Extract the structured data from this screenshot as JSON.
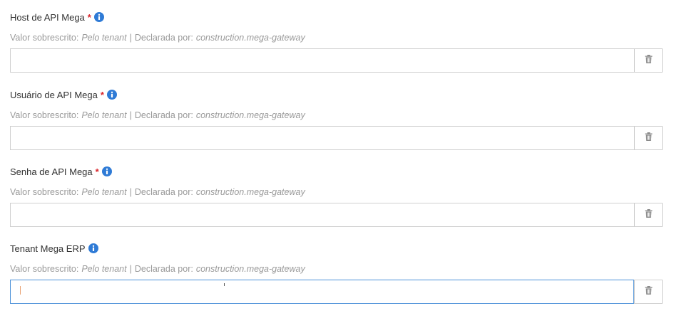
{
  "fields": [
    {
      "label": "Host de API Mega",
      "required": "*",
      "meta_prefix": "Valor sobrescrito:",
      "meta_overridden": "Pelo tenant",
      "meta_separator": "|",
      "meta_declared_prefix": "Declarada por:",
      "meta_declared_by": "construction.mega-gateway",
      "value": ""
    },
    {
      "label": "Usuário de API Mega",
      "required": "*",
      "meta_prefix": "Valor sobrescrito:",
      "meta_overridden": "Pelo tenant",
      "meta_separator": "|",
      "meta_declared_prefix": "Declarada por:",
      "meta_declared_by": "construction.mega-gateway",
      "value": ""
    },
    {
      "label": "Senha de API Mega",
      "required": "*",
      "meta_prefix": "Valor sobrescrito:",
      "meta_overridden": "Pelo tenant",
      "meta_separator": "|",
      "meta_declared_prefix": "Declarada por:",
      "meta_declared_by": "construction.mega-gateway",
      "value": ""
    },
    {
      "label": "Tenant Mega ERP",
      "meta_prefix": "Valor sobrescrito:",
      "meta_overridden": "Pelo tenant",
      "meta_separator": "|",
      "meta_declared_prefix": "Declarada por:",
      "meta_declared_by": "construction.mega-gateway",
      "value": ""
    }
  ],
  "icons": {
    "info": "info-icon",
    "delete": "trash-icon"
  },
  "colors": {
    "required": "#d9262c",
    "info": "#2f7bd6",
    "focus_border": "#4a90d9",
    "meta_text": "#9a9a9a"
  }
}
